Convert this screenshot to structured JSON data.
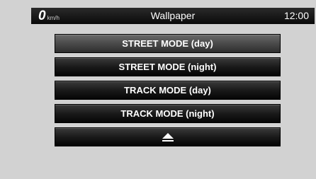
{
  "status_bar": {
    "speed_value": "0",
    "speed_unit": "km/h",
    "title": "Wallpaper",
    "clock": "12:00"
  },
  "menu": {
    "items": [
      {
        "label": "STREET MODE (day)",
        "selected": true
      },
      {
        "label": "STREET MODE (night)",
        "selected": false
      },
      {
        "label": "TRACK MODE (day)",
        "selected": false
      },
      {
        "label": "TRACK MODE (night)",
        "selected": false
      }
    ],
    "eject_icon": "eject-icon"
  },
  "colors": {
    "background": "#d2d2d2",
    "button": "#101010",
    "button_selected": "#4a4a4a",
    "text": "#ffffff"
  }
}
